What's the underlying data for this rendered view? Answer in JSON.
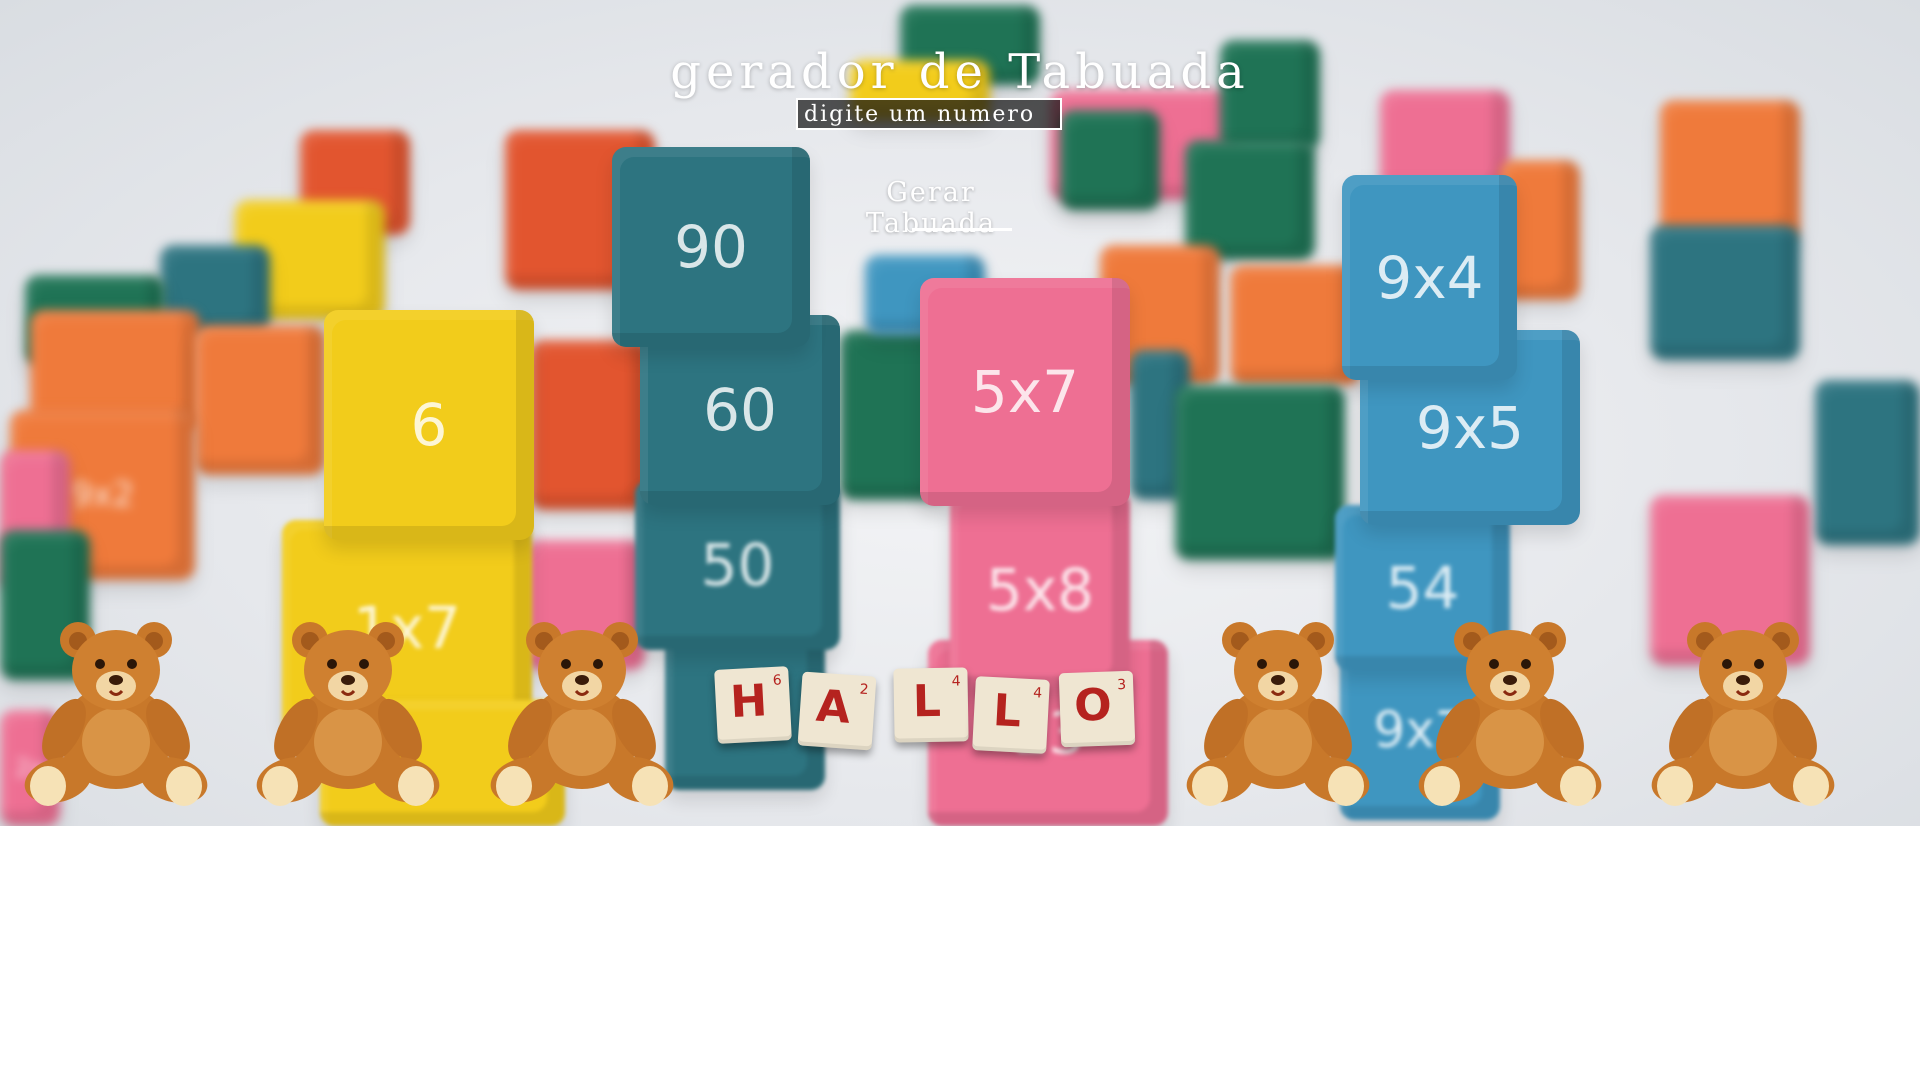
{
  "page": {
    "title": "gerador de Tabuada"
  },
  "form": {
    "number_placeholder": "digite um numero",
    "generate_label": "Gerar Tabuada"
  },
  "background": {
    "cubes": {
      "c1": "90",
      "c2": "60",
      "c3": "50",
      "c4": "6",
      "c5": "1x7",
      "c6": "5x7",
      "c7": "5x8",
      "c8": "13",
      "c9": "9x4",
      "c10": "9x5",
      "c11": "54",
      "c12": "9x7",
      "c13": "9x2",
      "c14": "2x"
    },
    "tiles": [
      {
        "letter": "H",
        "score": "6"
      },
      {
        "letter": "A",
        "score": "2"
      },
      {
        "letter": "L",
        "score": "4"
      },
      {
        "letter": "L",
        "score": "4"
      },
      {
        "letter": "O",
        "score": "3"
      }
    ]
  },
  "colors": {
    "yellow": "#f2cc1b",
    "teal": "#2d7480",
    "pink": "#ee6f93",
    "blue": "#3f96c0",
    "tile_letter": "#b5231f",
    "bear": "#c8782a"
  },
  "icons": {
    "bear": "teddy-bear-icon"
  }
}
